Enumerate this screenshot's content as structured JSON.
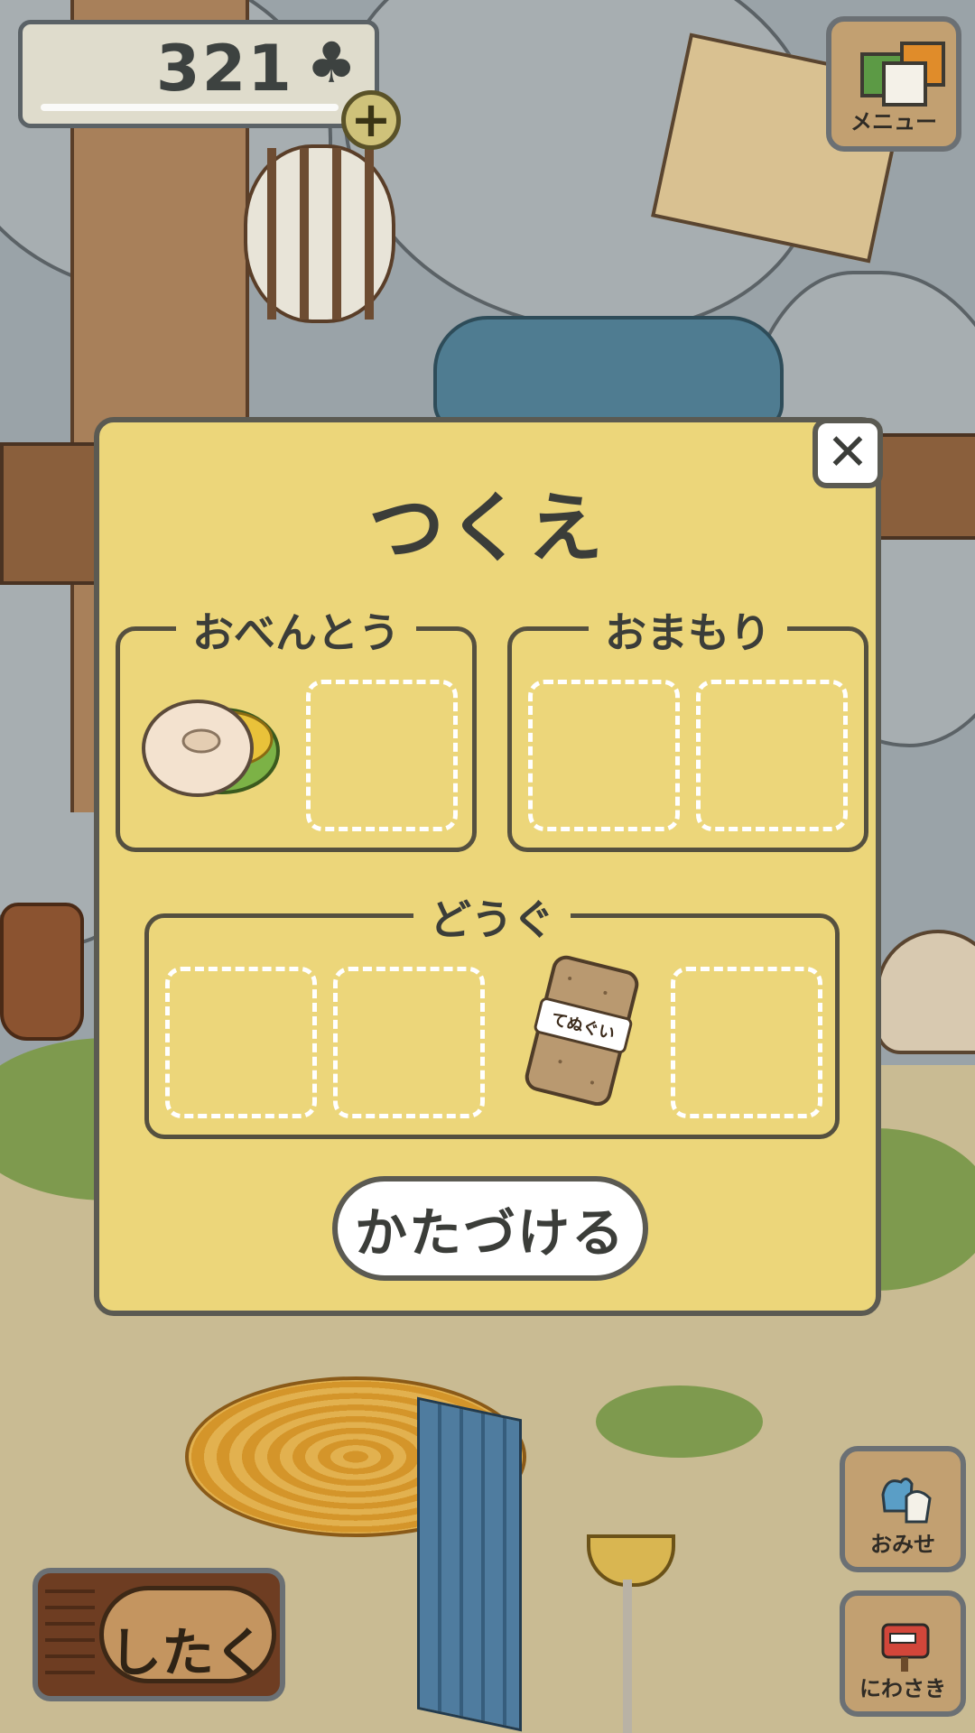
{
  "hud": {
    "clover_count": "321",
    "clover_icon": "club-clover-icon",
    "add_icon": "plus-icon",
    "menu_label": "メニュー"
  },
  "modal": {
    "title": "つくえ",
    "close_icon": "close-icon",
    "groups": {
      "lunch": {
        "label": "おべんとう",
        "slot_item": "bagel-sandwich"
      },
      "charm": {
        "label": "おまもり"
      },
      "tools": {
        "label": "どうぐ",
        "slot_item": "tenugui-towel",
        "item_text": "てぬぐい"
      }
    },
    "tidy_label": "かたづける"
  },
  "bottom": {
    "prep_label": "したく",
    "shop_label": "おみせ",
    "garden_label": "にわさき"
  },
  "colors": {
    "modal_bg": "#ecd67a",
    "modal_border": "#5b5a52",
    "slot_dash": "#ffffff",
    "button_wood": "#c2a071"
  }
}
